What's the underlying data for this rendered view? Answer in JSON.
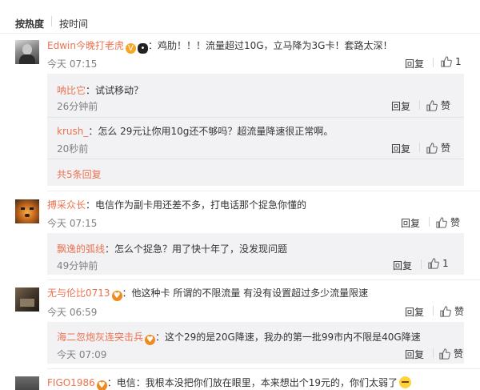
{
  "sort": {
    "hot": "按热度",
    "time": "按时间"
  },
  "comments": [
    {
      "user": "Edwin今晚打老虎",
      "text": "：鸡肋！！！流量超过10G，立马降为3G卡！套路太深！",
      "time": "今天 07:15",
      "reply_label": "回复",
      "likes": "1",
      "replies": [
        {
          "user": "呐比它",
          "text": "：试试移动？",
          "time": "26分钟前",
          "reply_label": "回复",
          "like_label": "赞"
        },
        {
          "user": "krush_",
          "text": "：怎么 29元让你用10g还不够吗？超流量降速很正常啊。",
          "time": "20秒前",
          "reply_label": "回复",
          "like_label": "赞"
        }
      ],
      "more_label": "共5条回复"
    },
    {
      "user": "搏采众长",
      "text": "：电信作为副卡用还差不多，打电话那个捉急你懂的",
      "time": "今天 07:15",
      "reply_label": "回复",
      "like_label": "赞",
      "replies": [
        {
          "user": "飘逸的弧线",
          "text": "：怎么个捉急？用了快十年了，没发现问题",
          "time": "49分钟前",
          "reply_label": "回复",
          "likes": "1"
        }
      ]
    },
    {
      "user": "无与伦比0713",
      "text": "：他这种卡 所谓的不限流量 有没有设置超过多少流量限速",
      "time": "今天 06:59",
      "reply_label": "回复",
      "like_label": "赞",
      "replies": [
        {
          "user": "海二忽炮灰连突击兵",
          "text": "：这个29的是20G降速，我办的第一批99市内不限是40G降速",
          "time": "今天 07:09",
          "reply_label": "回复",
          "like_label": "赞"
        }
      ]
    },
    {
      "user": "FIGO1986",
      "text": "：电信：我根本没把你们放在眼里，本来想出个19元的，你们太弱了"
    }
  ]
}
